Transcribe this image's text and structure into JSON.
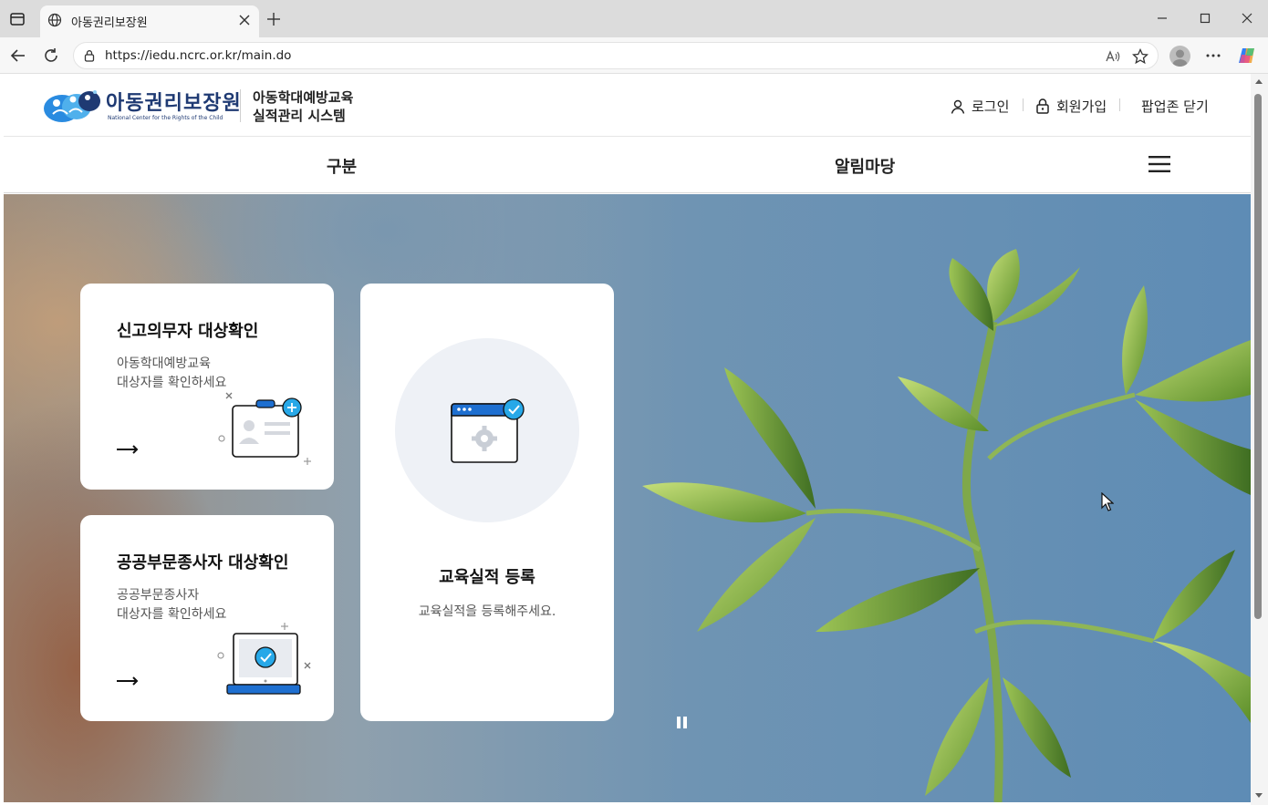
{
  "browser": {
    "tab_title": "아동권리보장원",
    "url": "https://iedu.ncrc.or.kr/main.do"
  },
  "header": {
    "logo_title": "아동권리보장원",
    "logo_subtitle": "National Center for the Rights of the Child",
    "system_name_line1": "아동학대예방교육",
    "system_name_line2": "실적관리 시스템",
    "login": "로그인",
    "signup": "회원가입",
    "close_popup": "팝업존 닫기"
  },
  "main_nav": {
    "items": [
      {
        "label": "구분"
      },
      {
        "label": "알림마당"
      }
    ]
  },
  "cards": {
    "reporter": {
      "title": "신고의무자 대상확인",
      "desc_line1": "아동학대예방교육",
      "desc_line2": "대상자를 확인하세요"
    },
    "public": {
      "title": "공공부문종사자 대상확인",
      "desc_line1": "공공부문종사자",
      "desc_line2": "대상자를 확인하세요"
    },
    "register": {
      "title": "교육실적 등록",
      "desc": "교육실적을 등록해주세요."
    }
  },
  "colors": {
    "brand_navy": "#1f3a73",
    "accent_blue": "#1e6fd0",
    "accent_cyan": "#27a8e8"
  }
}
